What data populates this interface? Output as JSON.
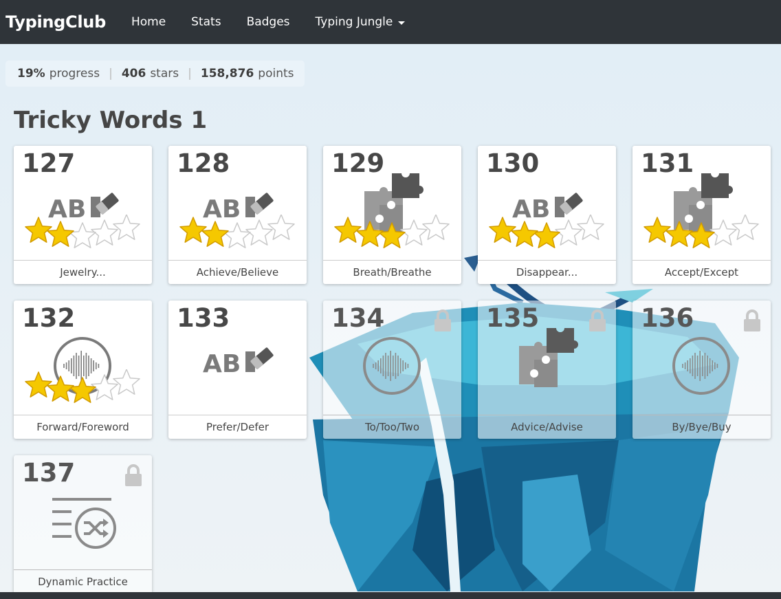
{
  "nav": {
    "brand": "TypingClub",
    "items": [
      {
        "label": "Home"
      },
      {
        "label": "Stats"
      },
      {
        "label": "Badges"
      },
      {
        "label": "Typing Jungle"
      }
    ]
  },
  "progress": {
    "percent": "19%",
    "percent_label": "progress",
    "stars": "406",
    "stars_label": "stars",
    "points": "158,876",
    "points_label": "points"
  },
  "section": {
    "title": "Tricky Words 1"
  },
  "lessons": [
    {
      "number": "127",
      "name": "Jewelry...",
      "icon": "abc-eraser-icon",
      "stars": 2,
      "locked": false
    },
    {
      "number": "128",
      "name": "Achieve/Believe",
      "icon": "abc-eraser-icon",
      "stars": 2,
      "locked": false
    },
    {
      "number": "129",
      "name": "Breath/Breathe",
      "icon": "puzzle-icon",
      "stars": 3,
      "locked": false
    },
    {
      "number": "130",
      "name": "Disappear...",
      "icon": "abc-eraser-icon",
      "stars": 3,
      "locked": false
    },
    {
      "number": "131",
      "name": "Accept/Except",
      "icon": "puzzle-icon",
      "stars": 3,
      "locked": false
    },
    {
      "number": "132",
      "name": "Forward/Foreword",
      "icon": "sound-wave-icon",
      "stars": 3,
      "locked": false
    },
    {
      "number": "133",
      "name": "Prefer/Defer",
      "icon": "abc-eraser-icon",
      "stars": 0,
      "locked": false
    },
    {
      "number": "134",
      "name": "To/Too/Two",
      "icon": "sound-wave-icon",
      "stars": 0,
      "locked": true
    },
    {
      "number": "135",
      "name": "Advice/Advise",
      "icon": "puzzle-icon",
      "stars": 0,
      "locked": true
    },
    {
      "number": "136",
      "name": "By/Bye/Buy",
      "icon": "sound-wave-icon",
      "stars": 0,
      "locked": true
    },
    {
      "number": "137",
      "name": "Dynamic Practice",
      "icon": "shuffle-list-icon",
      "stars": 0,
      "locked": true
    }
  ],
  "colors": {
    "navbar": "#2f3439",
    "star_filled": "#f5c800",
    "icon_gray": "#7a7a7a",
    "cliff_blue": "#1f7fa8"
  }
}
